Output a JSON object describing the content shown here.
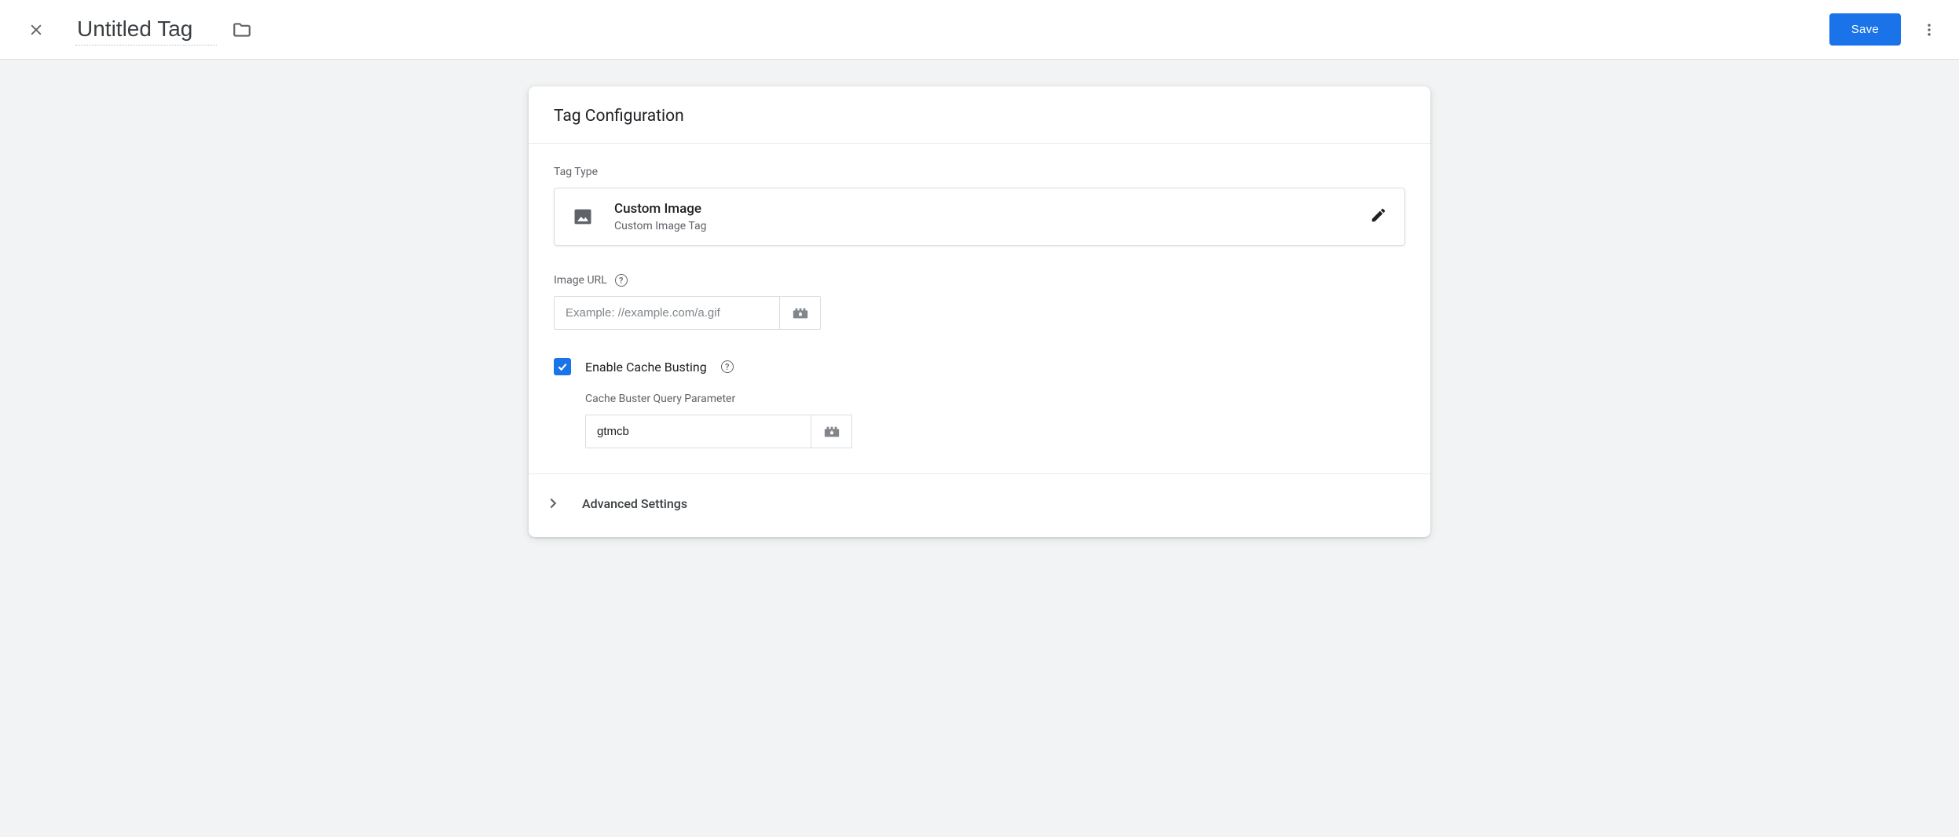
{
  "header": {
    "title": "Untitled Tag",
    "save_label": "Save"
  },
  "panel": {
    "title": "Tag Configuration",
    "tag_type_label": "Tag Type",
    "tag_type": {
      "name": "Custom Image",
      "subtitle": "Custom Image Tag"
    },
    "image_url": {
      "label": "Image URL",
      "placeholder": "Example: //example.com/a.gif",
      "value": ""
    },
    "cache_busting": {
      "label": "Enable Cache Busting",
      "checked": true,
      "param_label": "Cache Buster Query Parameter",
      "param_value": "gtmcb"
    },
    "advanced_label": "Advanced Settings"
  }
}
